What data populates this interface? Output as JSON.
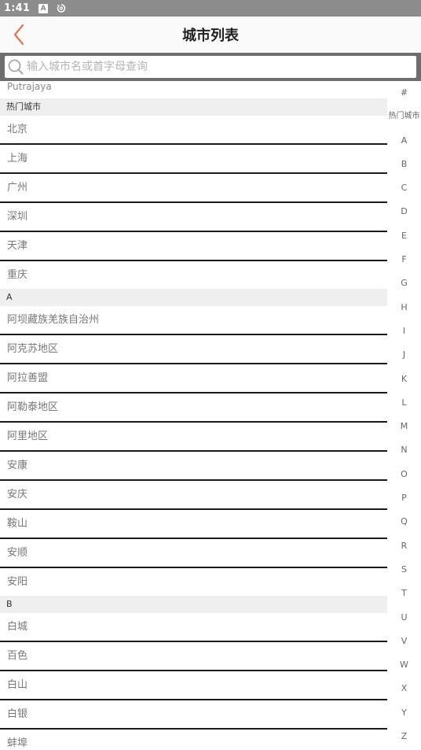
{
  "status_bar": {
    "time": "1:41",
    "box_icon_letter": "A"
  },
  "header": {
    "title": "城市列表",
    "accent": "#e8734a"
  },
  "search": {
    "placeholder": "输入城市名或首字母查询"
  },
  "list": {
    "lead_item": "Putrajaya",
    "sections": [
      {
        "header": "热门城市",
        "cities": [
          "北京",
          "上海",
          "广州",
          "深圳",
          "天津",
          "重庆"
        ]
      },
      {
        "header": "A",
        "cities": [
          "阿坝藏族羌族自治州",
          "阿克苏地区",
          "阿拉善盟",
          "阿勒泰地区",
          "阿里地区",
          "安康",
          "安庆",
          "鞍山",
          "安顺",
          "安阳"
        ]
      },
      {
        "header": "B",
        "cities": [
          "白城",
          "百色",
          "白山",
          "白银",
          "蚌埠"
        ]
      }
    ]
  },
  "index_bar": [
    "#",
    "热门城市",
    "A",
    "B",
    "C",
    "D",
    "E",
    "F",
    "G",
    "H",
    "I",
    "J",
    "K",
    "L",
    "M",
    "N",
    "O",
    "P",
    "Q",
    "R",
    "S",
    "T",
    "U",
    "V",
    "W",
    "X",
    "Y",
    "Z"
  ]
}
